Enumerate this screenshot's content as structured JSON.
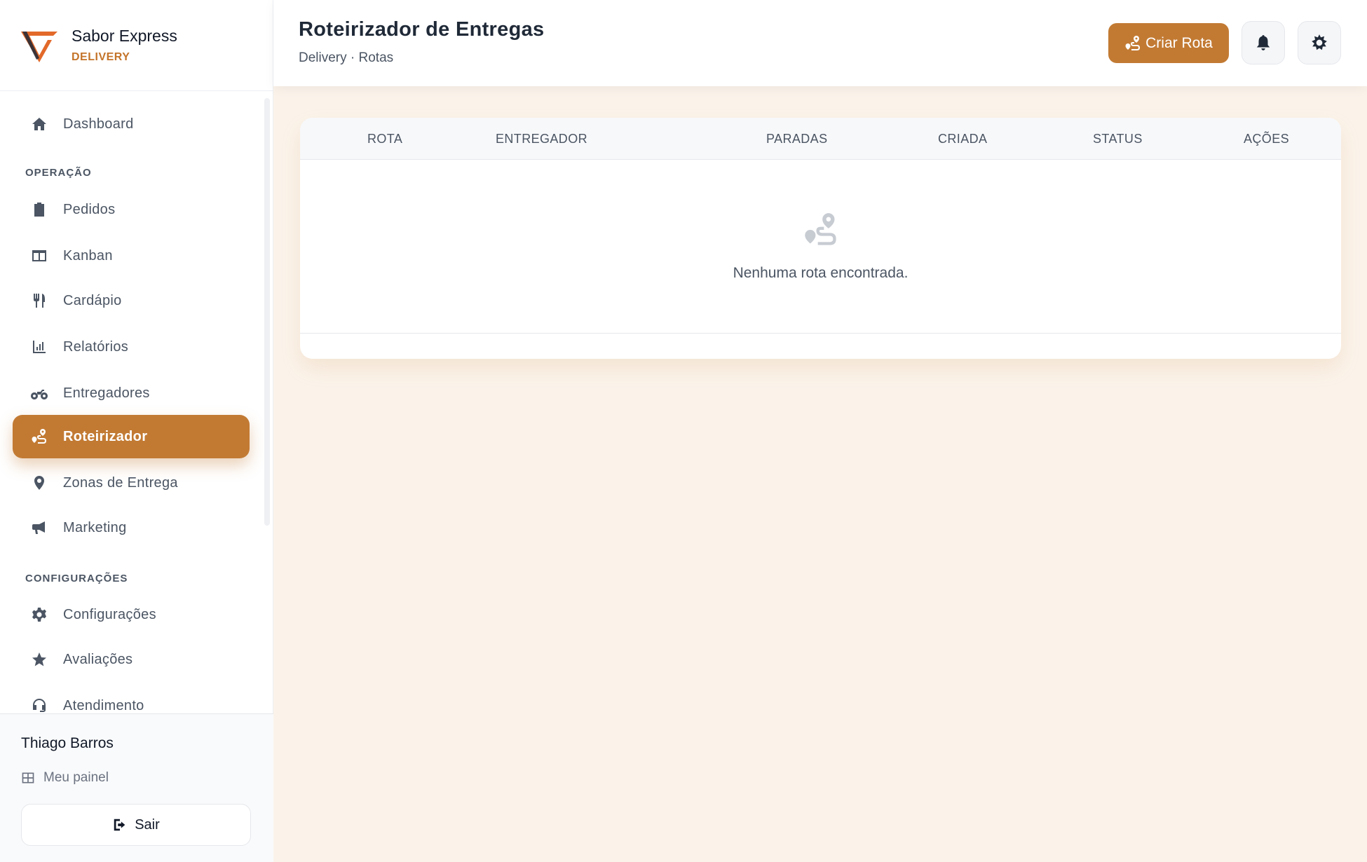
{
  "brand": {
    "name": "Sabor Express",
    "subtitle": "DELIVERY",
    "accent_color": "#c27a33"
  },
  "sidebar": {
    "items": [
      {
        "label": "Dashboard",
        "icon": "home-icon"
      },
      {
        "label": "Pedidos",
        "icon": "clipboard-icon"
      },
      {
        "label": "Kanban",
        "icon": "columns-icon"
      },
      {
        "label": "Cardápio",
        "icon": "utensils-icon"
      },
      {
        "label": "Relatórios",
        "icon": "chart-icon"
      },
      {
        "label": "Entregadores",
        "icon": "motorcycle-icon"
      },
      {
        "label": "Roteirizador",
        "icon": "route-icon",
        "active": true
      },
      {
        "label": "Zonas de Entrega",
        "icon": "map-pin-icon"
      },
      {
        "label": "Marketing",
        "icon": "megaphone-icon"
      },
      {
        "label": "Configurações",
        "icon": "gear-icon"
      },
      {
        "label": "Avaliações",
        "icon": "star-icon"
      },
      {
        "label": "Atendimento",
        "icon": "headset-icon"
      }
    ],
    "sections": {
      "operacao": "OPERAÇÃO",
      "configuracoes": "CONFIGURAÇÕES"
    }
  },
  "user": {
    "name": "Thiago Barros",
    "panel_label": "Meu painel",
    "logout_label": "Sair"
  },
  "header": {
    "title": "Roteirizador de Entregas",
    "breadcrumb": "Delivery · Rotas",
    "create_button": "Criar Rota"
  },
  "table": {
    "columns": [
      "ROTA",
      "ENTREGADOR",
      "PARADAS",
      "CRIADA",
      "STATUS",
      "AÇÕES"
    ],
    "rows": [],
    "empty_message": "Nenhuma rota encontrada."
  }
}
